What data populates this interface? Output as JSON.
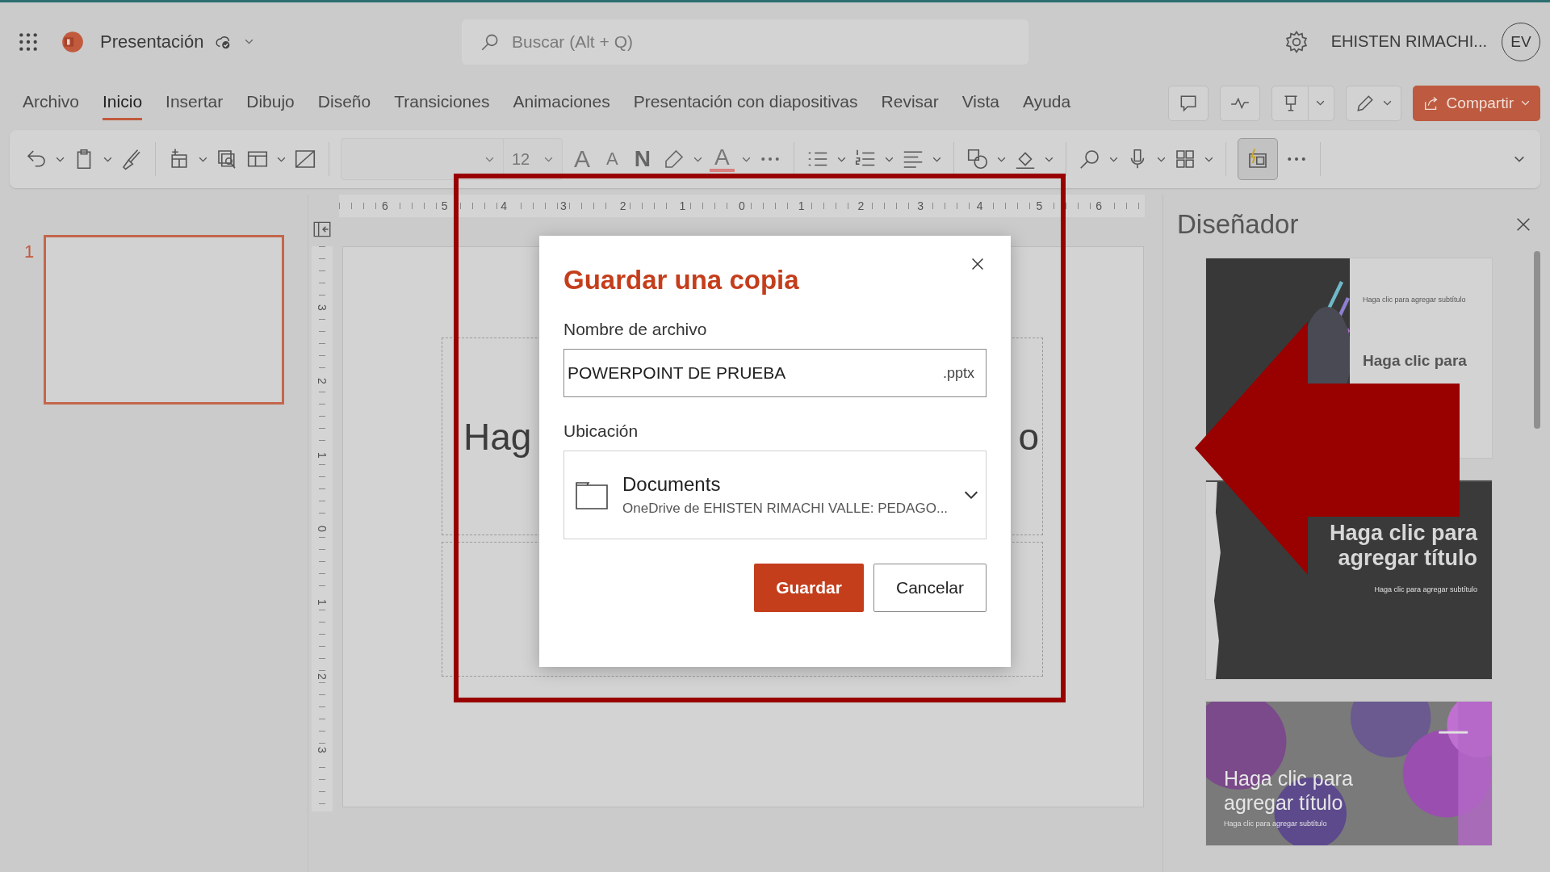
{
  "app_bar": {
    "document_title": "Presentación",
    "search": {
      "placeholder": "Buscar (Alt + Q)"
    },
    "user_name": "EHISTEN RIMACHI...",
    "avatar_initials": "EV"
  },
  "ribbon_tabs": [
    {
      "label": "Archivo",
      "selected": false
    },
    {
      "label": "Inicio",
      "selected": true
    },
    {
      "label": "Insertar",
      "selected": false
    },
    {
      "label": "Dibujo",
      "selected": false
    },
    {
      "label": "Diseño",
      "selected": false
    },
    {
      "label": "Transiciones",
      "selected": false
    },
    {
      "label": "Animaciones",
      "selected": false
    },
    {
      "label": "Presentación con diapositivas",
      "selected": false
    },
    {
      "label": "Revisar",
      "selected": false
    },
    {
      "label": "Vista",
      "selected": false
    },
    {
      "label": "Ayuda",
      "selected": false
    }
  ],
  "share_button": {
    "label": "Compartir"
  },
  "toolbar": {
    "font_size": "12",
    "format_buttons": [
      {
        "kind": "grow",
        "glyph": "A"
      },
      {
        "kind": "shrink",
        "glyph": "A"
      },
      {
        "kind": "bold",
        "glyph": "N"
      },
      {
        "kind": "highlight"
      },
      {
        "kind": "color",
        "glyph": "A"
      }
    ]
  },
  "slides_panel": {
    "slides": [
      {
        "number": "1",
        "selected": true
      }
    ]
  },
  "rulers": {
    "horizontal": [
      "6",
      "5",
      "4",
      "3",
      "2",
      "1",
      "0",
      "1",
      "2",
      "3",
      "4",
      "5",
      "6"
    ],
    "vertical": [
      "3",
      "2",
      "1",
      "0",
      "1",
      "2",
      "3"
    ]
  },
  "slide": {
    "title_start": "Hag",
    "title_end": "o"
  },
  "dialog": {
    "title": "Guardar una copia",
    "filename_label": "Nombre de archivo",
    "filename": "POWERPOINT DE PRUEBA",
    "extension": ".pptx",
    "location_label": "Ubicación",
    "location": {
      "name": "Documents",
      "path": "OneDrive de EHISTEN RIMACHI VALLE: PEDAGO..."
    },
    "buttons": [
      {
        "label": "Guardar",
        "kind": "primary"
      },
      {
        "label": "Cancelar",
        "kind": "secondary"
      }
    ]
  },
  "designer": {
    "title": "Diseñador",
    "designs": [
      {
        "kind": "neon",
        "subtitle": "Haga clic para agregar subtítulo",
        "title": "Haga clic para"
      },
      {
        "kind": "dark",
        "title": "Haga clic para agregar título",
        "subtitle": "Haga clic para agregar subtítulo"
      },
      {
        "kind": "purple",
        "title": "Haga clic para agregar título",
        "subtitle": "Haga clic para agregar subtítulo"
      }
    ]
  }
}
